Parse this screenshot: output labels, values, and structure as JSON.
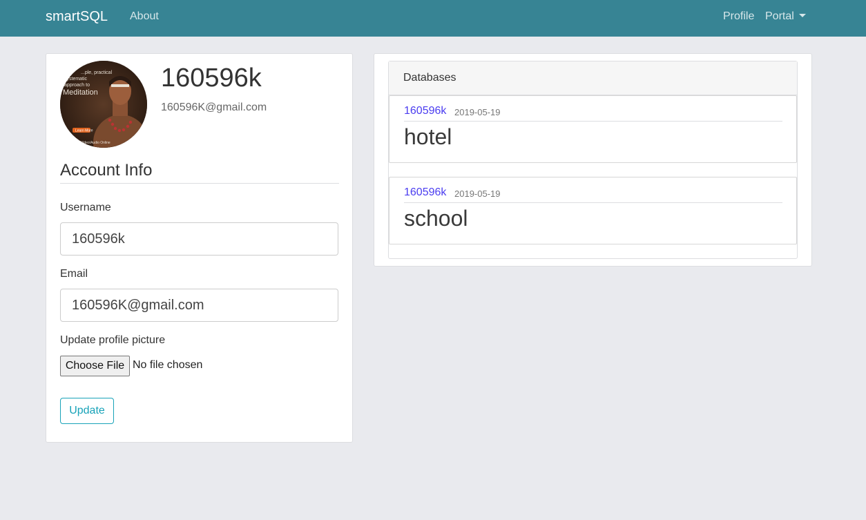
{
  "navbar": {
    "brand": "smartSQL",
    "about": "About",
    "profile": "Profile",
    "portal": "Portal"
  },
  "profile": {
    "name": "160596k",
    "email": "160596K@gmail.com",
    "avatar_text": [
      "...ple, practical",
      "systematic",
      "approach to",
      "Meditation",
      "Learn More",
      "Video/Audio Online"
    ]
  },
  "account": {
    "title": "Account Info",
    "username_label": "Username",
    "username_value": "160596k",
    "email_label": "Email",
    "email_value": "160596K@gmail.com",
    "picture_label": "Update profile picture",
    "choose_file": "Choose File",
    "no_file": "No file chosen",
    "update_button": "Update"
  },
  "databases": {
    "title": "Databases",
    "items": [
      {
        "owner": "160596k",
        "date": "2019-05-19",
        "name": "hotel"
      },
      {
        "owner": "160596k",
        "date": "2019-05-19",
        "name": "school"
      }
    ]
  },
  "colors": {
    "navbar": "#378494",
    "background": "#e9eaee",
    "link": "#4a3cf0",
    "update_button": "#17a2b8"
  }
}
